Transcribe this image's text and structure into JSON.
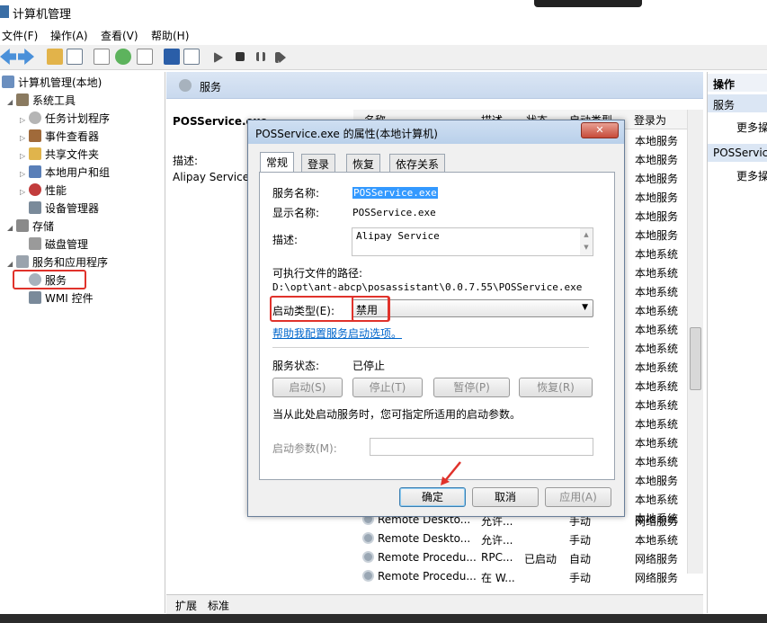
{
  "window": {
    "title": "计算机管理"
  },
  "menu": [
    "文件(F)",
    "操作(A)",
    "查看(V)",
    "帮助(H)"
  ],
  "tree": {
    "root": "计算机管理(本地)",
    "system_tools": "系统工具",
    "task_scheduler": "任务计划程序",
    "event_viewer": "事件查看器",
    "shared_folders": "共享文件夹",
    "local_users": "本地用户和组",
    "performance": "性能",
    "device_manager": "设备管理器",
    "storage": "存储",
    "disk_mgmt": "磁盘管理",
    "services_apps": "服务和应用程序",
    "services": "服务",
    "wmi": "WMI 控件"
  },
  "center": {
    "header": "服务",
    "selected_name": "POSService.exe",
    "desc_label": "描述:",
    "desc_value": "Alipay Service",
    "columns": [
      "名称",
      "描述",
      "状态",
      "启动类型",
      "登录为"
    ],
    "logon_col": [
      "本地服务",
      "本地服务",
      "本地服务",
      "本地服务",
      "本地服务",
      "本地服务",
      "本地系统",
      "本地系统",
      "本地系统",
      "本地系统",
      "本地系统",
      "本地系统",
      "本地系统",
      "本地系统",
      "本地系统",
      "本地系统",
      "本地系统",
      "本地系统",
      "本地服务",
      "本地系统",
      "本地系统"
    ],
    "rows": [
      {
        "name": "Remote Deskto...",
        "desc": "允许...",
        "status": "",
        "start": "手动",
        "logon": "网络服务"
      },
      {
        "name": "Remote Deskto...",
        "desc": "允许...",
        "status": "",
        "start": "手动",
        "logon": "本地系统"
      },
      {
        "name": "Remote Procedu...",
        "desc": "RPC...",
        "status": "已启动",
        "start": "自动",
        "logon": "网络服务"
      },
      {
        "name": "Remote Procedu...",
        "desc": "在 W...",
        "status": "",
        "start": "手动",
        "logon": "网络服务"
      }
    ],
    "bottom_tabs": [
      "扩展",
      "标准"
    ]
  },
  "actions": {
    "header": "操作",
    "group1": "服务",
    "more1": "更多操",
    "group2": "POSServic",
    "more2": "更多操"
  },
  "dialog": {
    "title": "POSService.exe 的属性(本地计算机)",
    "close": "✕",
    "tabs": [
      "常规",
      "登录",
      "恢复",
      "依存关系"
    ],
    "service_name_label": "服务名称:",
    "service_name": "POSService.exe",
    "display_name_label": "显示名称:",
    "display_name": "POSService.exe",
    "desc_label": "描述:",
    "desc": "Alipay Service",
    "path_label": "可执行文件的路径:",
    "path": "D:\\opt\\ant-abcp\\posassistant\\0.0.7.55\\POSService.exe",
    "startup_label": "启动类型(E):",
    "startup_value": "禁用",
    "help_link": "帮助我配置服务启动选项。",
    "status_label": "服务状态:",
    "status_value": "已停止",
    "btn_start": "启动(S)",
    "btn_stop": "停止(T)",
    "btn_pause": "暂停(P)",
    "btn_resume": "恢复(R)",
    "hint": "当从此处启动服务时，您可指定所适用的启动参数。",
    "params_label": "启动参数(M):",
    "ok": "确定",
    "cancel": "取消",
    "apply": "应用(A)"
  }
}
